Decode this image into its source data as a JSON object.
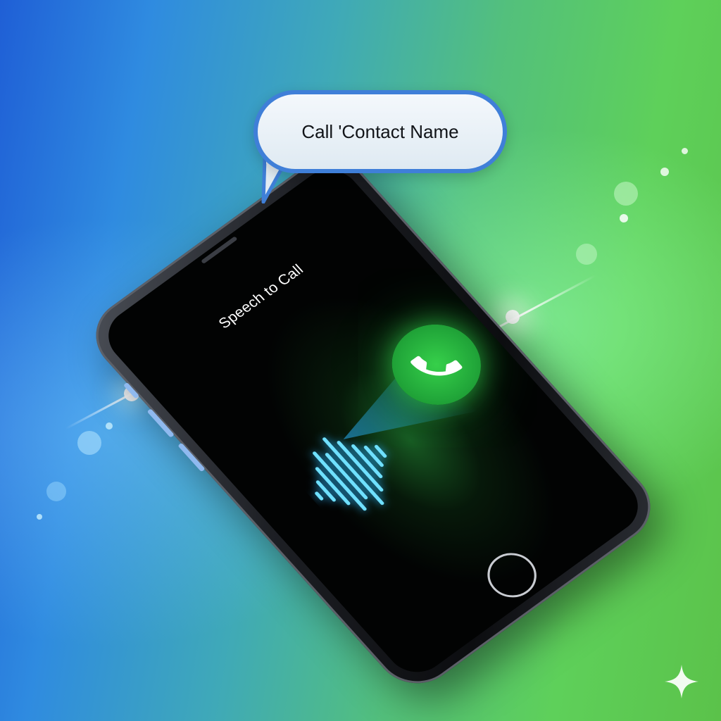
{
  "bubble": {
    "text": "Call 'Contact Name"
  },
  "screen": {
    "title": "Speech to Call"
  },
  "icons": {
    "call": "phone-handset-icon",
    "wave": "sound-wave-icon",
    "sparkle": "sparkle-icon"
  },
  "colors": {
    "background_left": "#1f5fd6",
    "background_right": "#5bc24a",
    "bubble_border": "#3f7fd8",
    "call_button": "#22a83a",
    "wave": "#6fe0ff"
  }
}
